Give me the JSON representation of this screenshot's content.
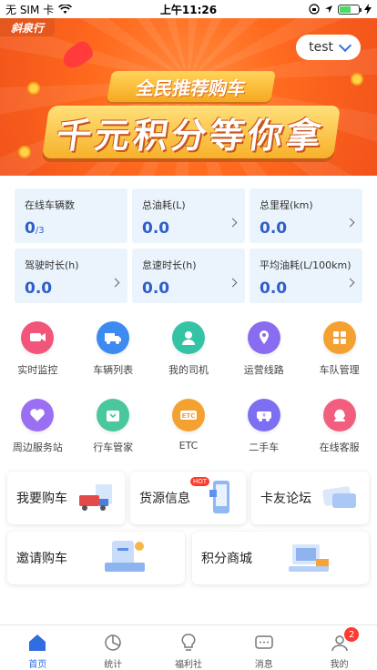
{
  "status_bar": {
    "carrier": "无 SIM 卡",
    "time": "上午11:26",
    "battery_level": 0.6
  },
  "banner": {
    "logo_text": "斜泉行",
    "user_name": "test",
    "subtitle": "全民推荐购车",
    "title": "千元积分等你拿"
  },
  "stats": [
    {
      "label": "在线车辆数",
      "value": "0",
      "suffix": "/3",
      "has_arrow": false
    },
    {
      "label": "总油耗(L)",
      "value": "0.0",
      "suffix": "",
      "has_arrow": true
    },
    {
      "label": "总里程(km)",
      "value": "0.0",
      "suffix": "",
      "has_arrow": true
    },
    {
      "label": "驾驶时长(h)",
      "value": "0.0",
      "suffix": "",
      "has_arrow": true
    },
    {
      "label": "怠速时长(h)",
      "value": "0.0",
      "suffix": "",
      "has_arrow": true
    },
    {
      "label": "平均油耗(L/100km)",
      "value": "0.0",
      "suffix": "",
      "has_arrow": true
    }
  ],
  "features": [
    {
      "label": "实时监控",
      "icon": "camera-icon",
      "color": "#f2557a"
    },
    {
      "label": "车辆列表",
      "icon": "truck-icon",
      "color": "#3d8bf2"
    },
    {
      "label": "我的司机",
      "icon": "driver-icon",
      "color": "#35c3a6"
    },
    {
      "label": "运营线路",
      "icon": "route-icon",
      "color": "#8a6cf0"
    },
    {
      "label": "车队管理",
      "icon": "fleet-icon",
      "color": "#f4a131"
    },
    {
      "label": "周边服务站",
      "icon": "service-station-icon",
      "color": "#9b6ff2"
    },
    {
      "label": "行车管家",
      "icon": "steward-icon",
      "color": "#4ac79c"
    },
    {
      "label": "ETC",
      "icon": "etc-icon",
      "color": "#f4a131"
    },
    {
      "label": "二手车",
      "icon": "used-car-icon",
      "color": "#7d6ff2"
    },
    {
      "label": "在线客服",
      "icon": "customer-service-icon",
      "color": "#f25f7e"
    }
  ],
  "cards": {
    "buy_car": "我要购车",
    "cargo_info": "货源信息",
    "hot_badge": "HOT",
    "forum": "卡友论坛",
    "invite": "邀请购车",
    "points_mall": "积分商城"
  },
  "tabbar": {
    "items": [
      {
        "label": "首页",
        "icon": "home-icon"
      },
      {
        "label": "统计",
        "icon": "stats-icon"
      },
      {
        "label": "福利社",
        "icon": "lightbulb-icon"
      },
      {
        "label": "消息",
        "icon": "message-icon"
      },
      {
        "label": "我的",
        "icon": "profile-icon"
      }
    ],
    "profile_badge": "2"
  }
}
